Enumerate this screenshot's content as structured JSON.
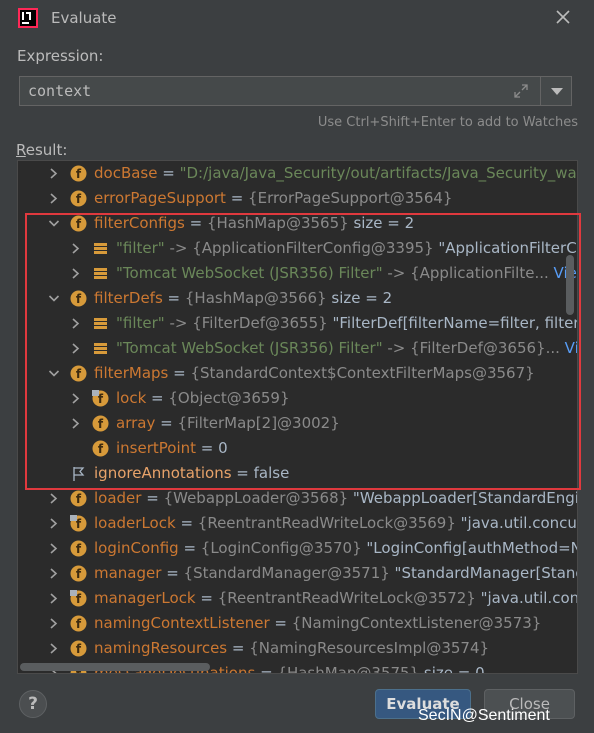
{
  "window": {
    "title": "Evaluate",
    "app_icon": "intellij-icon",
    "close_icon": "close-icon"
  },
  "expression": {
    "label": "Expression:",
    "value": "context",
    "hint": "Use Ctrl+Shift+Enter to add to Watches"
  },
  "result": {
    "label_first": "R",
    "label_rest": "esult:"
  },
  "tree": {
    "rows": [
      {
        "indent": 0,
        "arrow": "right",
        "icon": "field-icon",
        "name": "docBase",
        "eq": " = ",
        "str": "\"D:/java/Java_Security/out/artifacts/Java_Security_war_e",
        "ref": "",
        "extra": "",
        "link": ""
      },
      {
        "indent": 0,
        "arrow": "right",
        "icon": "field-icon",
        "name": "errorPageSupport",
        "eq": " = ",
        "str": "",
        "ref": "{ErrorPageSupport@3564}",
        "extra": "",
        "link": ""
      },
      {
        "indent": 0,
        "arrow": "down",
        "icon": "field-icon",
        "name": "filterConfigs",
        "eq": " = ",
        "str": "",
        "ref": "{HashMap@3565}",
        "extra": "  size = 2",
        "link": ""
      },
      {
        "indent": 1,
        "arrow": "right",
        "icon": "entry-icon",
        "name": "",
        "eq": "",
        "str": "\"filter\"",
        "ref": " -> {ApplicationFilterConfig@3395}",
        "extra": " \"ApplicationFilterCor",
        "link": ""
      },
      {
        "indent": 1,
        "arrow": "right",
        "icon": "entry-icon",
        "name": "",
        "eq": "",
        "str": "\"Tomcat WebSocket (JSR356) Filter\"",
        "ref": " -> {ApplicationFilte...",
        "extra": "",
        "link": " View"
      },
      {
        "indent": 0,
        "arrow": "down",
        "icon": "field-icon",
        "name": "filterDefs",
        "eq": " = ",
        "str": "",
        "ref": "{HashMap@3566}",
        "extra": "  size = 2",
        "link": ""
      },
      {
        "indent": 1,
        "arrow": "right",
        "icon": "entry-icon",
        "name": "",
        "eq": "",
        "str": "\"filter\"",
        "ref": " -> {FilterDef@3655}",
        "extra": " \"FilterDef[filterName=filter, filterCla",
        "link": ""
      },
      {
        "indent": 1,
        "arrow": "right",
        "icon": "entry-icon",
        "name": "",
        "eq": "",
        "str": "\"Tomcat WebSocket (JSR356) Filter\"",
        "ref": " -> {FilterDef@3656}...",
        "extra": "",
        "link": " View"
      },
      {
        "indent": 0,
        "arrow": "down",
        "icon": "field-icon",
        "name": "filterMaps",
        "eq": " = ",
        "str": "",
        "ref": "{StandardContext$ContextFilterMaps@3567}",
        "extra": "",
        "link": ""
      },
      {
        "indent": 1,
        "arrow": "right",
        "icon": "field-lock-icon",
        "name": "lock",
        "eq": " = ",
        "str": "",
        "ref": "{Object@3659}",
        "extra": "",
        "link": ""
      },
      {
        "indent": 1,
        "arrow": "right",
        "icon": "field-icon",
        "name": "array",
        "eq": " = ",
        "str": "",
        "ref": "{FilterMap[2]@3002}",
        "extra": "",
        "link": ""
      },
      {
        "indent": 1,
        "arrow": "none",
        "icon": "field-icon",
        "name": "insertPoint",
        "eq": " = ",
        "str": "",
        "ref": "",
        "extra": "0",
        "link": ""
      },
      {
        "indent": 0,
        "arrow": "none",
        "icon": "flag-icon",
        "name": "ignoreAnnotations",
        "eq": " = ",
        "str": "",
        "ref": "",
        "extra": "false",
        "link": ""
      },
      {
        "indent": 0,
        "arrow": "right",
        "icon": "field-icon",
        "name": "loader",
        "eq": " = ",
        "str": "",
        "ref": "{WebappLoader@3568}",
        "extra": " \"WebappLoader[StandardEngine",
        "link": ""
      },
      {
        "indent": 0,
        "arrow": "right",
        "icon": "field-lock-icon",
        "name": "loaderLock",
        "eq": " = ",
        "str": "",
        "ref": "{ReentrantReadWriteLock@3569}",
        "extra": " \"java.util.concurrer",
        "link": ""
      },
      {
        "indent": 0,
        "arrow": "right",
        "icon": "field-icon",
        "name": "loginConfig",
        "eq": " = ",
        "str": "",
        "ref": "{LoginConfig@3570}",
        "extra": " \"LoginConfig[authMethod=NO",
        "link": ""
      },
      {
        "indent": 0,
        "arrow": "right",
        "icon": "field-icon",
        "name": "manager",
        "eq": " = ",
        "str": "",
        "ref": "{StandardManager@3571}",
        "extra": " \"StandardManager[Standarc",
        "link": ""
      },
      {
        "indent": 0,
        "arrow": "right",
        "icon": "field-lock-icon",
        "name": "managerLock",
        "eq": " = ",
        "str": "",
        "ref": "{ReentrantReadWriteLock@3572}",
        "extra": " \"java.util.concurr",
        "link": ""
      },
      {
        "indent": 0,
        "arrow": "right",
        "icon": "field-icon",
        "name": "namingContextListener",
        "eq": " = ",
        "str": "",
        "ref": "{NamingContextListener@3573}",
        "extra": "",
        "link": ""
      },
      {
        "indent": 0,
        "arrow": "right",
        "icon": "field-icon",
        "name": "namingResources",
        "eq": " = ",
        "str": "",
        "ref": "{NamingResourcesImpl@3574}",
        "extra": "",
        "link": ""
      },
      {
        "indent": 0,
        "arrow": "right",
        "icon": "field-icon",
        "name": "messageDestinations",
        "eq": " = ",
        "str": "",
        "ref": "{HashMap@3575}",
        "extra": "  size = 0",
        "link": ""
      }
    ]
  },
  "highlight_color": "#e0393e",
  "buttons": {
    "help": "?",
    "evaluate": "Evaluate",
    "close": "Close"
  },
  "watermark": "SecIN@Sentiment"
}
